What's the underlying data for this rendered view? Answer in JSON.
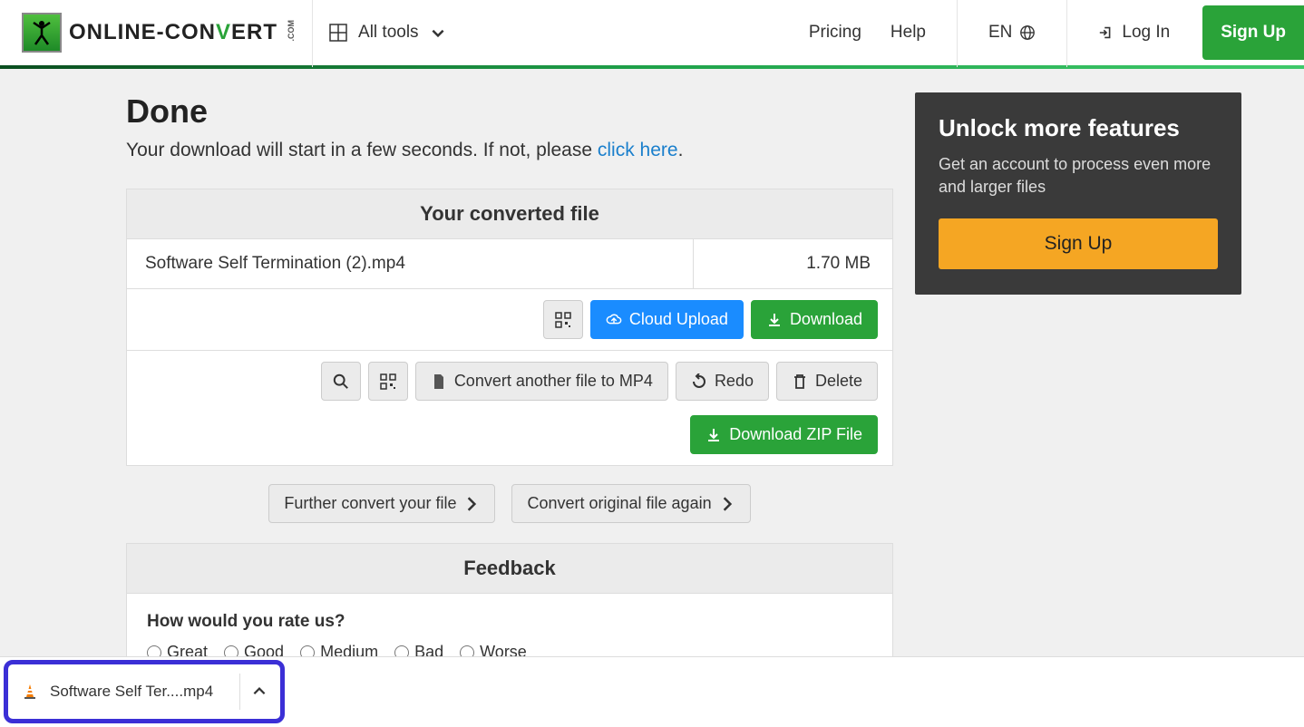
{
  "nav": {
    "brand_prefix": "ONLINE-CON",
    "brand_v": "V",
    "brand_suffix": "ERT",
    "brand_com": ".COM",
    "all_tools": "All tools",
    "pricing": "Pricing",
    "help": "Help",
    "lang": "EN",
    "login": "Log In",
    "signup": "Sign Up"
  },
  "page": {
    "title": "Done",
    "subtitle_before": "Your download will start in a few seconds. If not, please ",
    "subtitle_link": "click here",
    "subtitle_after": "."
  },
  "converted": {
    "header": "Your converted file",
    "filename": "Software Self Termination (2).mp4",
    "filesize": "1.70 MB",
    "cloud_upload": "Cloud Upload",
    "download": "Download",
    "convert_another": "Convert another file to MP4",
    "redo": "Redo",
    "delete": "Delete",
    "download_zip": "Download ZIP File"
  },
  "further": {
    "further_convert": "Further convert your file",
    "convert_original": "Convert original file again"
  },
  "feedback": {
    "header": "Feedback",
    "question": "How would you rate us?",
    "options": [
      "Great",
      "Good",
      "Medium",
      "Bad",
      "Worse"
    ]
  },
  "promo": {
    "title": "Unlock more features",
    "text": "Get an account to process even more and larger files",
    "cta": "Sign Up"
  },
  "download_bar": {
    "filename": "Software Self Ter....mp4"
  }
}
